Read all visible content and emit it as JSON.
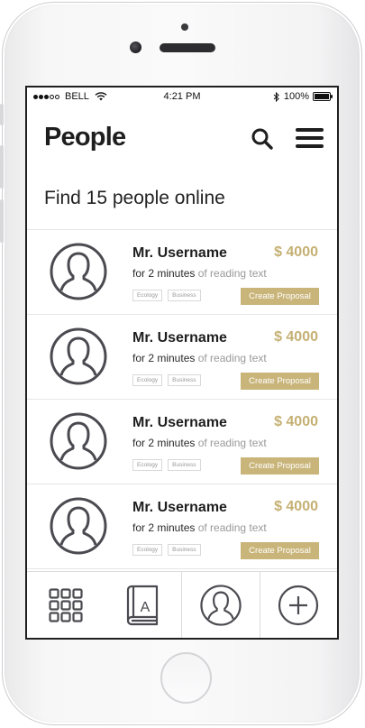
{
  "status_bar": {
    "carrier": "BELL",
    "time": "4:21 PM",
    "battery": "100%",
    "battery_level": 1.0,
    "signal_dots_filled": 3,
    "signal_dots_total": 5
  },
  "header": {
    "title": "People",
    "search_icon": "search-icon",
    "menu_icon": "hamburger-menu-icon"
  },
  "headline": "Find 15 people online",
  "colors": {
    "accent": "#c9b57a",
    "price": "#c5b073",
    "text_dark": "#1e1e1e",
    "text_muted": "#999999"
  },
  "people": [
    {
      "name": "Mr. Username",
      "price": "$ 4000",
      "desc_strong": "for 2 minutes",
      "desc_rest": " of reading text",
      "tags": [
        "Ecology",
        "Business"
      ],
      "button": "Create Proposal",
      "avatar_icon": "user-avatar-icon"
    },
    {
      "name": "Mr. Username",
      "price": "$ 4000",
      "desc_strong": "for 2 minutes",
      "desc_rest": " of reading text",
      "tags": [
        "Ecology",
        "Business"
      ],
      "button": "Create Proposal",
      "avatar_icon": "user-avatar-icon"
    },
    {
      "name": "Mr. Username",
      "price": "$ 4000",
      "desc_strong": "for 2 minutes",
      "desc_rest": " of reading text",
      "tags": [
        "Ecology",
        "Business"
      ],
      "button": "Create Proposal",
      "avatar_icon": "user-avatar-icon"
    },
    {
      "name": "Mr. Username",
      "price": "$ 4000",
      "desc_strong": "for 2 minutes",
      "desc_rest": " of reading text",
      "tags": [
        "Ecology",
        "Business"
      ],
      "button": "Create Proposal",
      "avatar_icon": "user-avatar-icon"
    }
  ],
  "bottom_nav": [
    {
      "icon": "grid-icon"
    },
    {
      "icon": "book-icon",
      "letter": "A"
    },
    {
      "icon": "profile-icon"
    },
    {
      "icon": "add-icon"
    }
  ]
}
